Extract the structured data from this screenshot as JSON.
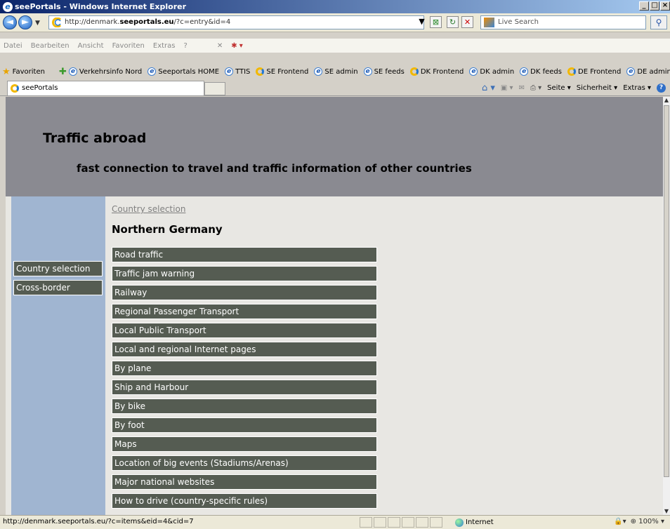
{
  "window": {
    "title": "seePortals - Windows Internet Explorer",
    "controls": [
      "_",
      "□",
      "×"
    ]
  },
  "address_bar": {
    "url_prefix": "http://denmark.",
    "url_domain": "seeportals.eu",
    "url_suffix": "/?c=entry&id=4",
    "search_placeholder": "Live Search"
  },
  "menu": {
    "items": [
      "Datei",
      "Bearbeiten",
      "Ansicht",
      "Favoriten",
      "Extras",
      "?"
    ]
  },
  "favorites_bar": {
    "label": "Favoriten",
    "items": [
      {
        "label": "Verkehrsinfo Nord",
        "icon": "ie-icon"
      },
      {
        "label": "Seeportals HOME",
        "icon": "ie-icon"
      },
      {
        "label": "TTIS",
        "icon": "ie-icon"
      },
      {
        "label": "SE Frontend",
        "icon": "seeportals-icon"
      },
      {
        "label": "SE admin",
        "icon": "ie-icon"
      },
      {
        "label": "SE feeds",
        "icon": "ie-icon"
      },
      {
        "label": "DK Frontend",
        "icon": "seeportals-icon"
      },
      {
        "label": "DK admin",
        "icon": "ie-icon"
      },
      {
        "label": "DK feeds",
        "icon": "ie-icon"
      },
      {
        "label": "DE Frontend",
        "icon": "seeportals-icon"
      },
      {
        "label": "DE admin",
        "icon": "ie-icon"
      }
    ]
  },
  "tab": {
    "label": "seePortals"
  },
  "command_bar": {
    "page": "Seite",
    "security": "Sicherheit",
    "tools": "Extras"
  },
  "page": {
    "title": "Traffic abroad",
    "subtitle": "fast connection to travel and traffic information of other countries",
    "sidebar": [
      "Country selection",
      "Cross-border"
    ],
    "breadcrumb": "Country selection",
    "region": "Northern Germany",
    "categories": [
      "Road traffic",
      "Traffic jam warning",
      "Railway",
      "Regional Passenger Transport",
      "Local Public Transport",
      "Local and regional Internet pages",
      "By plane",
      "Ship and Harbour",
      "By bike",
      "By foot",
      "Maps",
      "Location of big events (Stadiums/Arenas)",
      "Major national websites",
      "How to drive (country-specific rules)"
    ]
  },
  "status_bar": {
    "url": "http://denmark.seeportals.eu/?c=items&eid=4&cid=7",
    "zone": "Internet",
    "zoom": "100%"
  },
  "colors": {
    "header_bg": "#8a8a91",
    "sidebar_bg": "#a0b5d1",
    "button_bg": "#555c52",
    "content_bg": "#e8e7e3"
  }
}
